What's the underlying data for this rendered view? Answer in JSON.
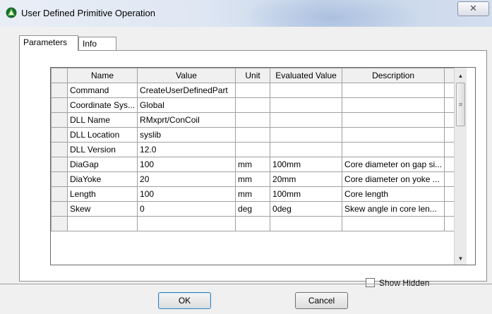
{
  "window": {
    "title": "User Defined Primitive Operation",
    "close_glyph": "✕",
    "app_icon": "green-tree-icon"
  },
  "tabs": [
    {
      "label": "Parameters",
      "active": true
    },
    {
      "label": "Info",
      "active": false
    }
  ],
  "grid": {
    "columns": [
      "Name",
      "Value",
      "Unit",
      "Evaluated Value",
      "Description"
    ],
    "rows": [
      [
        "Command",
        "CreateUserDefinedPart",
        "",
        "",
        ""
      ],
      [
        "Coordinate Sys...",
        "Global",
        "",
        "",
        ""
      ],
      [
        "DLL Name",
        "RMxprt/ConCoil",
        "",
        "",
        ""
      ],
      [
        "DLL Location",
        "syslib",
        "",
        "",
        ""
      ],
      [
        "DLL Version",
        "12.0",
        "",
        "",
        ""
      ],
      [
        "DiaGap",
        "100",
        "mm",
        "100mm",
        "Core diameter on gap si..."
      ],
      [
        "DiaYoke",
        "20",
        "mm",
        "20mm",
        "Core diameter on yoke ..."
      ],
      [
        "Length",
        "100",
        "mm",
        "100mm",
        "Core length"
      ],
      [
        "Skew",
        "0",
        "deg",
        "0deg",
        "Skew angle in core len..."
      ]
    ]
  },
  "show_hidden": {
    "label": "Show Hidden",
    "checked": false
  },
  "buttons": {
    "ok": "OK",
    "cancel": "Cancel"
  },
  "colors": {
    "title_accent": "#c7d6ea",
    "dialog_bg": "#f0f0f0"
  }
}
